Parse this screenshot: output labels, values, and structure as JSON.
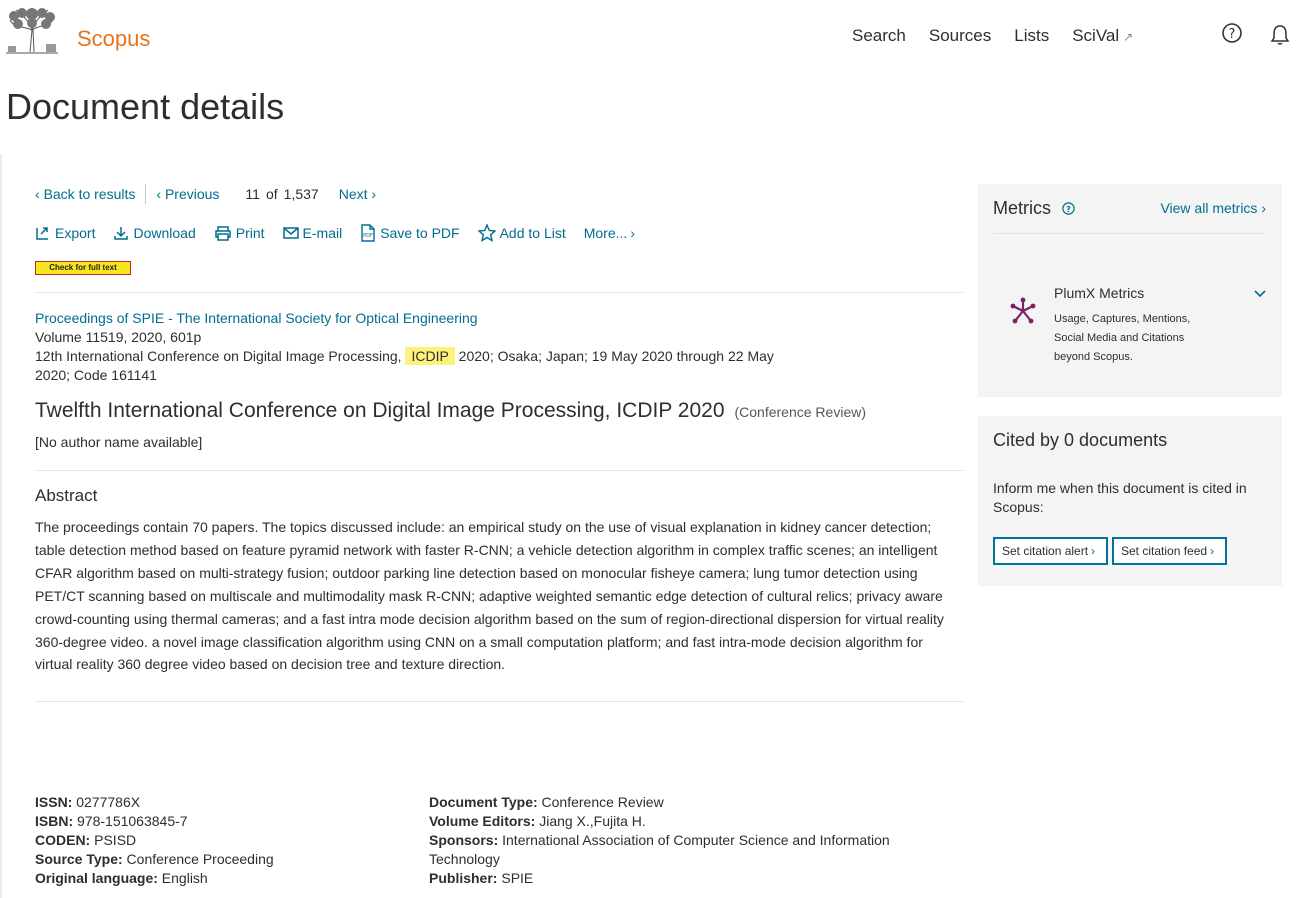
{
  "header": {
    "brand": "Scopus",
    "nav": [
      "Search",
      "Sources",
      "Lists",
      "SciVal"
    ],
    "scival_ext": "↗"
  },
  "page_title": "Document details",
  "navrow": {
    "back": "Back to results",
    "previous": "Previous",
    "current": "11",
    "of": "of",
    "total": "1,537",
    "next": "Next"
  },
  "actions": {
    "export": "Export",
    "download": "Download",
    "print": "Print",
    "email": "E-mail",
    "save_pdf": "Save to PDF",
    "add_list": "Add to List",
    "more": "More..."
  },
  "fulltext_button": "Check for full text",
  "source": {
    "journal": "Proceedings of SPIE - The International Society for Optical Engineering",
    "volume": "Volume 11519, 2020, 601p",
    "conf_pre": "12th International Conference on Digital Image Processing, ",
    "conf_highlight": "ICDIP",
    "conf_post": " 2020; Osaka; Japan; 19 May 2020 through 22 May 2020; Code 161141"
  },
  "doc": {
    "title": "Twelfth International Conference on Digital Image Processing, ICDIP 2020",
    "type": "(Conference Review)",
    "authors": "[No author name available]"
  },
  "abstract": {
    "heading": "Abstract",
    "text": "The proceedings contain 70 papers. The topics discussed include: an empirical study on the use of visual explanation in kidney cancer detection; table detection method based on feature pyramid network with faster R-CNN; a vehicle detection algorithm in complex traffic scenes; an intelligent CFAR algorithm based on multi-strategy fusion; outdoor parking line detection based on monocular fisheye camera; lung tumor detection using PET/CT scanning based on multiscale and multimodality mask R-CNN; adaptive weighted semantic edge detection of cultural relics; privacy aware crowd-counting using thermal cameras; and a fast intra mode decision algorithm based on the sum of region-directional dispersion for virtual reality 360-degree video. a novel image classification algorithm using CNN on a small computation platform; and fast intra-mode decision algorithm for virtual reality 360 degree video based on decision tree and texture direction."
  },
  "meta": {
    "issn_label": "ISSN:",
    "issn": "0277786X",
    "isbn_label": "ISBN:",
    "isbn": "978-151063845-7",
    "coden_label": "CODEN:",
    "coden": "PSISD",
    "source_type_label": "Source Type:",
    "source_type": "Conference Proceeding",
    "orig_lang_label": "Original language:",
    "orig_lang": "English",
    "doc_type_label": "Document Type:",
    "doc_type": "Conference Review",
    "editors_label": "Volume Editors:",
    "editors": "Jiang X.,Fujita H.",
    "sponsors_label": "Sponsors:",
    "sponsors": "International Association of Computer Science and Information Technology",
    "publisher_label": "Publisher:",
    "publisher": "SPIE"
  },
  "metrics": {
    "heading": "Metrics",
    "view_all": "View all metrics",
    "plumx_title": "PlumX Metrics",
    "plumx_desc": "Usage, Captures, Mentions, Social Media and Citations beyond Scopus."
  },
  "cited": {
    "heading": "Cited by 0 documents",
    "inform": "Inform me when this document is cited in Scopus:",
    "alert_btn": "Set citation alert",
    "feed_btn": "Set citation feed"
  },
  "colors": {
    "brand": "#e9711c",
    "link": "#006d8f",
    "highlight": "#fdf27c",
    "plumx": "#7b1f6a",
    "panel_bg": "#f4f4f4"
  }
}
